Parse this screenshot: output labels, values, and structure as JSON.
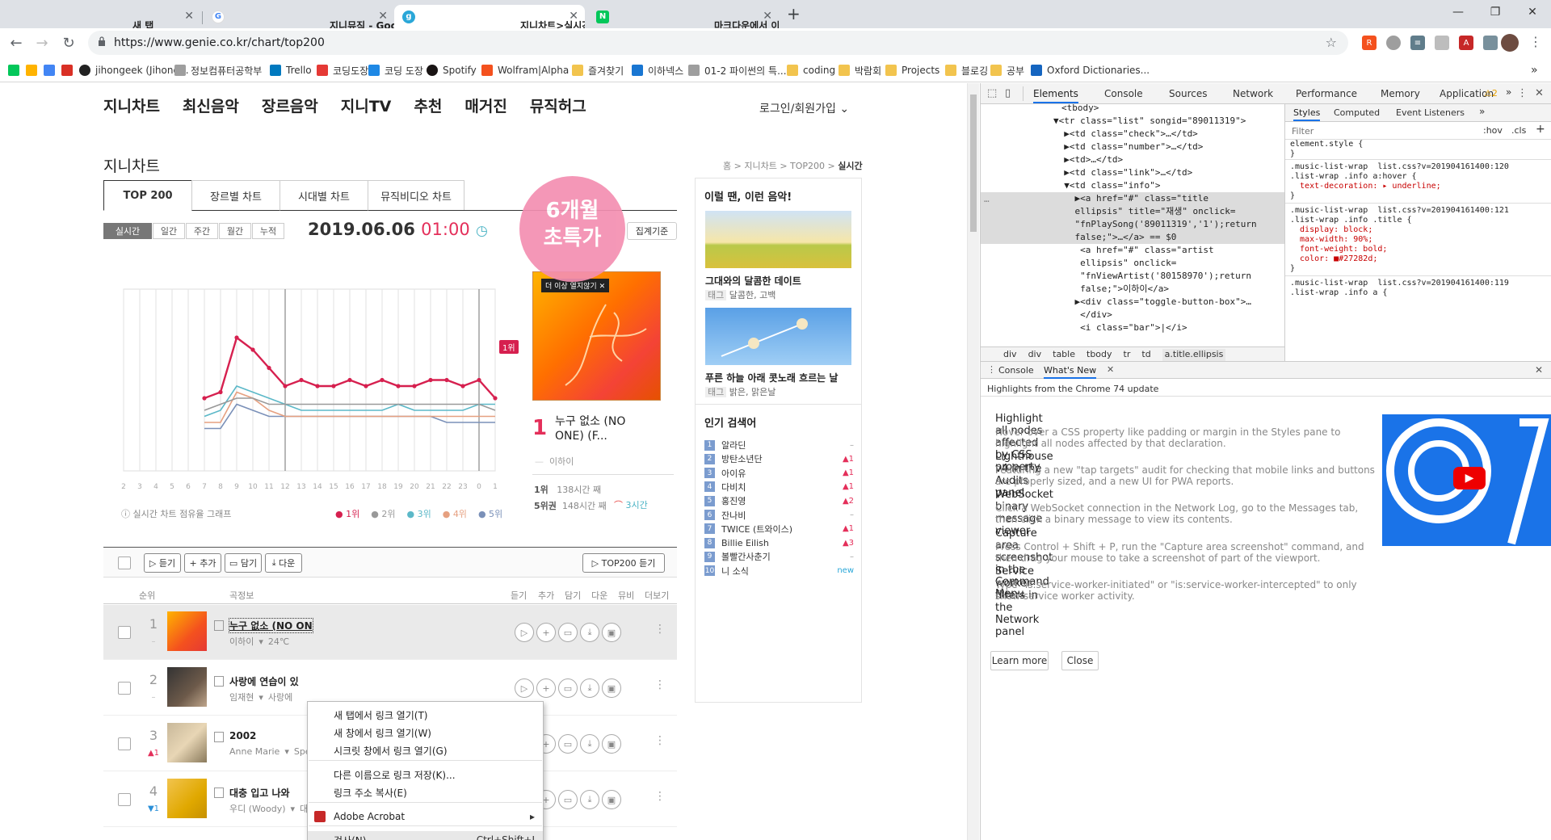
{
  "browser": {
    "tabs": [
      {
        "title": "새 탭",
        "active": false
      },
      {
        "title": "지니뮤직 - Google 검색",
        "active": false
      },
      {
        "title": "지니차트>실시간 - 지니",
        "active": true
      },
      {
        "title": "마크다운에서 이미지 넣기 : 네이",
        "active": false
      }
    ],
    "new_tab": "+",
    "url": "https://www.genie.co.kr/chart/top200",
    "bookmarks": [
      {
        "label": "",
        "icon": "naver-icon",
        "color": "#03c75a"
      },
      {
        "label": "",
        "icon": "daum-icon",
        "color": "#ffb300"
      },
      {
        "label": "",
        "icon": "google-icon",
        "color": "#4285f4"
      },
      {
        "label": "",
        "icon": "gmail-icon",
        "color": "#d93025"
      },
      {
        "label": "jihongeek (Jihong...",
        "icon": "github-icon",
        "color": "#222222"
      },
      {
        "label": "정보컴퓨터공학부",
        "icon": "univ-icon",
        "color": "#9e9e9e"
      },
      {
        "label": "Trello",
        "icon": "trello-icon",
        "color": "#0079bf"
      },
      {
        "label": "코딩도장",
        "icon": "codingdojang-icon",
        "color": "#e53935"
      },
      {
        "label": "코딩 도장",
        "icon": "codingdojang2-icon",
        "color": "#1e88e5"
      },
      {
        "label": "Spotify",
        "icon": "spotify-icon",
        "color": "#191414"
      },
      {
        "label": "Wolfram|Alpha",
        "icon": "wolfram-icon",
        "color": "#f4511e"
      },
      {
        "label": "즐겨찾기",
        "icon": "folder-icon",
        "color": "#f2c44e"
      },
      {
        "label": "이하넥스",
        "icon": "ihanex-icon",
        "color": "#1976d2"
      },
      {
        "label": "01-2 파이썬의 특...",
        "icon": "doc-icon",
        "color": "#9e9e9e"
      },
      {
        "label": "coding",
        "icon": "folder-icon",
        "color": "#f2c44e"
      },
      {
        "label": "박람회",
        "icon": "folder-icon",
        "color": "#f2c44e"
      },
      {
        "label": "Projects",
        "icon": "folder-icon",
        "color": "#f2c44e"
      },
      {
        "label": "블로깅",
        "icon": "folder-icon",
        "color": "#f2c44e"
      },
      {
        "label": "공부",
        "icon": "folder-icon",
        "color": "#f2c44e"
      },
      {
        "label": "Oxford Dictionaries...",
        "icon": "oxford-icon",
        "color": "#1565c0"
      }
    ],
    "bookmarks_more": "»"
  },
  "site": {
    "nav": [
      "지니차트",
      "최신음악",
      "장르음악",
      "지니TV",
      "추천",
      "매거진",
      "뮤직허그"
    ],
    "login": "로그인/회원가입",
    "section_title": "지니차트",
    "breadcrumb": [
      "홈",
      "지니차트",
      "TOP200",
      "실시간"
    ],
    "chart_tabs": [
      "TOP 200",
      "장르별 차트",
      "시대별 차트",
      "뮤직비디오 차트"
    ],
    "periods": [
      "실시간",
      "일간",
      "주간",
      "월간",
      "누적"
    ],
    "date": "2019.06.06",
    "hour": "01:00",
    "tally_button": "집계기준",
    "promo": [
      "6개월",
      "초특가"
    ],
    "album_close_label": "더 이상 열지않기",
    "now1": {
      "rank": "1",
      "title": "누구 없소 (NO ONE) (F...",
      "artist": "이하이"
    },
    "stats": [
      {
        "label": "1위",
        "value": "138시간 째"
      },
      {
        "label": "5위권",
        "value": "148시간 째"
      }
    ],
    "rainbow_label": "3시간",
    "chart_caption": "실시간 차트 점유율 그래프",
    "chart_marker": "1위",
    "legend": [
      "1위",
      "2위",
      "3위",
      "4위",
      "5위"
    ],
    "legend_colors": [
      "#d6204f",
      "#999999",
      "#5bb8c8",
      "#e6a080",
      "#7a90b8"
    ]
  },
  "chart_data": {
    "type": "line",
    "x": [
      "2",
      "3",
      "4",
      "5",
      "6",
      "7",
      "8",
      "9",
      "10",
      "11",
      "12",
      "13",
      "14",
      "15",
      "16",
      "17",
      "18",
      "19",
      "20",
      "21",
      "22",
      "23",
      "0",
      "1"
    ],
    "series": [
      {
        "name": "1위",
        "values": [
          null,
          null,
          null,
          null,
          null,
          12,
          13,
          22,
          20,
          17,
          14,
          15,
          14,
          14,
          15,
          14,
          15,
          14,
          14,
          15,
          15,
          14,
          15,
          12
        ]
      },
      {
        "name": "2위",
        "values": [
          null,
          null,
          null,
          null,
          null,
          10,
          11,
          12,
          12,
          11,
          11,
          11,
          11,
          11,
          11,
          11,
          11,
          11,
          11,
          11,
          11,
          11,
          11,
          10
        ]
      },
      {
        "name": "3위",
        "values": [
          null,
          null,
          null,
          null,
          null,
          9,
          10,
          14,
          13,
          12,
          11,
          10,
          10,
          10,
          10,
          10,
          10,
          11,
          10,
          10,
          10,
          10,
          11,
          11
        ]
      },
      {
        "name": "4위",
        "values": [
          null,
          null,
          null,
          null,
          null,
          8,
          8,
          13,
          12,
          10,
          9,
          9,
          9,
          9,
          9,
          9,
          9,
          9,
          9,
          9,
          9,
          9,
          9,
          9
        ]
      },
      {
        "name": "5위",
        "values": [
          null,
          null,
          null,
          null,
          null,
          7,
          7,
          11,
          10,
          9,
          9,
          9,
          9,
          9,
          9,
          9,
          9,
          9,
          9,
          9,
          8,
          8,
          8,
          8
        ]
      }
    ],
    "ylim": [
      0,
      30
    ],
    "grid": true,
    "legend_position": "bottom-right"
  },
  "popular": {
    "title": "인기 검색어",
    "items": [
      {
        "rank": "1",
        "word": "알라딘",
        "change": "–"
      },
      {
        "rank": "2",
        "word": "방탄소년단",
        "change": "▲1"
      },
      {
        "rank": "3",
        "word": "아이유",
        "change": "▲1"
      },
      {
        "rank": "4",
        "word": "다비치",
        "change": "▲1"
      },
      {
        "rank": "5",
        "word": "홍진영",
        "change": "▲2"
      },
      {
        "rank": "6",
        "word": "잔나비",
        "change": "–"
      },
      {
        "rank": "7",
        "word": "TWICE (트와이스)",
        "change": "▲1"
      },
      {
        "rank": "8",
        "word": "Billie Eilish",
        "change": "▲3"
      },
      {
        "rank": "9",
        "word": "볼빨간사춘기",
        "change": "–"
      },
      {
        "rank": "10",
        "word": "니 소식",
        "change": "new"
      }
    ]
  },
  "recommend": {
    "title": "이럴 땐, 이런 음악!",
    "items": [
      {
        "title": "그대와의 달콤한 데이트",
        "tag_label": "태그",
        "tags": "달콤한, 고백"
      },
      {
        "title": "푸른 하늘 아래 콧노래 흐르는 날",
        "tag_label": "태그",
        "tags": "밝은, 맑은날"
      }
    ]
  },
  "list": {
    "buttons": [
      "듣기",
      "추가",
      "담기",
      "다운"
    ],
    "top200_button": "TOP200 듣기",
    "headers": [
      "순위",
      "곡정보",
      "듣기",
      "추가",
      "담기",
      "다운",
      "뮤비",
      "더보기"
    ],
    "rows": [
      {
        "rank": "1",
        "change": "–",
        "title": "누구 없소 (NO ON",
        "artist": "이하이",
        "extra": "24℃"
      },
      {
        "rank": "2",
        "change": "–",
        "title": "사랑에 연습이 있",
        "artist": "임재현",
        "extra": "사랑에"
      },
      {
        "rank": "3",
        "change": "▲1",
        "title": "2002",
        "artist": "Anne Marie",
        "extra": "Spe"
      },
      {
        "rank": "4",
        "change": "▼1",
        "title": "대충 입고 나와",
        "artist": "우디 (Woody)",
        "extra": "대충 입고 나와"
      }
    ]
  },
  "context_menu": {
    "items": [
      {
        "label": "새 탭에서 링크 열기(T)",
        "shortcut": ""
      },
      {
        "label": "새 창에서 링크 열기(W)",
        "shortcut": ""
      },
      {
        "label": "시크릿 창에서 링크 열기(G)",
        "shortcut": ""
      },
      {
        "label": "다른 이름으로 링크 저장(K)...",
        "shortcut": ""
      },
      {
        "label": "링크 주소 복사(E)",
        "shortcut": ""
      },
      {
        "label": "Adobe Acrobat",
        "shortcut": "▸"
      },
      {
        "label": "검사(N)",
        "shortcut": "Ctrl+Shift+I"
      }
    ]
  },
  "devtools": {
    "tabs": [
      "Elements",
      "Console",
      "Sources",
      "Network",
      "Performance",
      "Memory",
      "Application"
    ],
    "more": "»",
    "warnings": "2",
    "dom_lines": [
      "<tbody>",
      "▼<tr class=\"list\" songid=\"89011319\">",
      "  ▶<td class=\"check\">…</td>",
      "  ▶<td class=\"number\">…</td>",
      "  ▶<td>…</td>",
      "  ▶<td class=\"link\">…</td>",
      "  ▼<td class=\"info\">",
      "    ▶<a href=\"#\" class=\"title",
      "    ellipsis\" title=\"재생\" onclick=",
      "    \"fnPlaySong('89011319','1');return",
      "    false;\">…</a> == $0",
      "     <a href=\"#\" class=\"artist",
      "     ellipsis\" onclick=",
      "     \"fnViewArtist('80158970');return",
      "     false;\">이하이</a>",
      "    ▶<div class=\"toggle-button-box\">…",
      "     </div>",
      "     <i class=\"bar\">|</i>"
    ],
    "dom_breadcrumb": [
      "div",
      "div",
      "table",
      "tbody",
      "tr",
      "td",
      "a.title.ellipsis"
    ],
    "styles_tabs": [
      "Styles",
      "Computed",
      "Event Listeners"
    ],
    "filter_placeholder": "Filter",
    "hov": ":hov",
    "cls": ".cls",
    "css_lines": [
      "element.style {",
      "}",
      ".music-list-wrap  list.css?v=201904161400:120",
      ".list-wrap .info a:hover {",
      "  text-decoration: ▸ underline;",
      "}",
      ".music-list-wrap  list.css?v=201904161400:121",
      ".list-wrap .info .title {",
      "  display: block;",
      "  max-width: 90%;",
      "  font-weight: bold;",
      "  color: ■#27282d;",
      "}",
      ".music-list-wrap  list.css?v=201904161400:119",
      ".list-wrap .info a {"
    ],
    "drawer_tabs": [
      "Console",
      "What's New"
    ],
    "whats_new_header": "Highlights from the Chrome 74 update",
    "whats_new": [
      {
        "h": "Highlight all nodes affected by CSS property",
        "p": "Hover over a CSS property like padding or margin in the Styles pane to highlight all nodes affected by that declaration."
      },
      {
        "h": "Lighthouse v4 in the Audits panel",
        "p": "Featuring a new \"tap targets\" audit for checking that mobile links and buttons are properly sized, and a new UI for PWA reports."
      },
      {
        "h": "WebSocket binary message viewer",
        "p": "Click a WebSocket connection in the Network Log, go to the Messages tab, then click a binary message to view its contents."
      },
      {
        "h": "Capture area screenshot in the Command Menu",
        "p": "Press Control + Shift + P, run the \"Capture area screenshot\" command, and then drag your mouse to take a screenshot of part of the viewport."
      },
      {
        "h": "Service worker filters in the Network panel",
        "p": "Type \"is:service-worker-initiated\" or \"is:service-worker-intercepted\" to only show service worker activity."
      }
    ],
    "learn_more": "Learn more",
    "close": "Close"
  }
}
